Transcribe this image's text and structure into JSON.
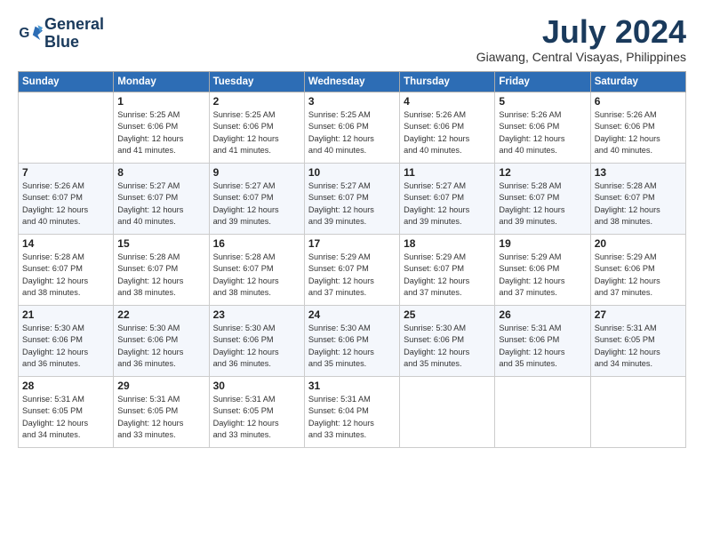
{
  "header": {
    "logo_line1": "General",
    "logo_line2": "Blue",
    "month": "July 2024",
    "location": "Giawang, Central Visayas, Philippines"
  },
  "weekdays": [
    "Sunday",
    "Monday",
    "Tuesday",
    "Wednesday",
    "Thursday",
    "Friday",
    "Saturday"
  ],
  "weeks": [
    [
      {
        "day": "",
        "info": ""
      },
      {
        "day": "1",
        "info": "Sunrise: 5:25 AM\nSunset: 6:06 PM\nDaylight: 12 hours\nand 41 minutes."
      },
      {
        "day": "2",
        "info": "Sunrise: 5:25 AM\nSunset: 6:06 PM\nDaylight: 12 hours\nand 41 minutes."
      },
      {
        "day": "3",
        "info": "Sunrise: 5:25 AM\nSunset: 6:06 PM\nDaylight: 12 hours\nand 40 minutes."
      },
      {
        "day": "4",
        "info": "Sunrise: 5:26 AM\nSunset: 6:06 PM\nDaylight: 12 hours\nand 40 minutes."
      },
      {
        "day": "5",
        "info": "Sunrise: 5:26 AM\nSunset: 6:06 PM\nDaylight: 12 hours\nand 40 minutes."
      },
      {
        "day": "6",
        "info": "Sunrise: 5:26 AM\nSunset: 6:06 PM\nDaylight: 12 hours\nand 40 minutes."
      }
    ],
    [
      {
        "day": "7",
        "info": "Sunrise: 5:26 AM\nSunset: 6:07 PM\nDaylight: 12 hours\nand 40 minutes."
      },
      {
        "day": "8",
        "info": "Sunrise: 5:27 AM\nSunset: 6:07 PM\nDaylight: 12 hours\nand 40 minutes."
      },
      {
        "day": "9",
        "info": "Sunrise: 5:27 AM\nSunset: 6:07 PM\nDaylight: 12 hours\nand 39 minutes."
      },
      {
        "day": "10",
        "info": "Sunrise: 5:27 AM\nSunset: 6:07 PM\nDaylight: 12 hours\nand 39 minutes."
      },
      {
        "day": "11",
        "info": "Sunrise: 5:27 AM\nSunset: 6:07 PM\nDaylight: 12 hours\nand 39 minutes."
      },
      {
        "day": "12",
        "info": "Sunrise: 5:28 AM\nSunset: 6:07 PM\nDaylight: 12 hours\nand 39 minutes."
      },
      {
        "day": "13",
        "info": "Sunrise: 5:28 AM\nSunset: 6:07 PM\nDaylight: 12 hours\nand 38 minutes."
      }
    ],
    [
      {
        "day": "14",
        "info": "Sunrise: 5:28 AM\nSunset: 6:07 PM\nDaylight: 12 hours\nand 38 minutes."
      },
      {
        "day": "15",
        "info": "Sunrise: 5:28 AM\nSunset: 6:07 PM\nDaylight: 12 hours\nand 38 minutes."
      },
      {
        "day": "16",
        "info": "Sunrise: 5:28 AM\nSunset: 6:07 PM\nDaylight: 12 hours\nand 38 minutes."
      },
      {
        "day": "17",
        "info": "Sunrise: 5:29 AM\nSunset: 6:07 PM\nDaylight: 12 hours\nand 37 minutes."
      },
      {
        "day": "18",
        "info": "Sunrise: 5:29 AM\nSunset: 6:07 PM\nDaylight: 12 hours\nand 37 minutes."
      },
      {
        "day": "19",
        "info": "Sunrise: 5:29 AM\nSunset: 6:06 PM\nDaylight: 12 hours\nand 37 minutes."
      },
      {
        "day": "20",
        "info": "Sunrise: 5:29 AM\nSunset: 6:06 PM\nDaylight: 12 hours\nand 37 minutes."
      }
    ],
    [
      {
        "day": "21",
        "info": "Sunrise: 5:30 AM\nSunset: 6:06 PM\nDaylight: 12 hours\nand 36 minutes."
      },
      {
        "day": "22",
        "info": "Sunrise: 5:30 AM\nSunset: 6:06 PM\nDaylight: 12 hours\nand 36 minutes."
      },
      {
        "day": "23",
        "info": "Sunrise: 5:30 AM\nSunset: 6:06 PM\nDaylight: 12 hours\nand 36 minutes."
      },
      {
        "day": "24",
        "info": "Sunrise: 5:30 AM\nSunset: 6:06 PM\nDaylight: 12 hours\nand 35 minutes."
      },
      {
        "day": "25",
        "info": "Sunrise: 5:30 AM\nSunset: 6:06 PM\nDaylight: 12 hours\nand 35 minutes."
      },
      {
        "day": "26",
        "info": "Sunrise: 5:31 AM\nSunset: 6:06 PM\nDaylight: 12 hours\nand 35 minutes."
      },
      {
        "day": "27",
        "info": "Sunrise: 5:31 AM\nSunset: 6:05 PM\nDaylight: 12 hours\nand 34 minutes."
      }
    ],
    [
      {
        "day": "28",
        "info": "Sunrise: 5:31 AM\nSunset: 6:05 PM\nDaylight: 12 hours\nand 34 minutes."
      },
      {
        "day": "29",
        "info": "Sunrise: 5:31 AM\nSunset: 6:05 PM\nDaylight: 12 hours\nand 33 minutes."
      },
      {
        "day": "30",
        "info": "Sunrise: 5:31 AM\nSunset: 6:05 PM\nDaylight: 12 hours\nand 33 minutes."
      },
      {
        "day": "31",
        "info": "Sunrise: 5:31 AM\nSunset: 6:04 PM\nDaylight: 12 hours\nand 33 minutes."
      },
      {
        "day": "",
        "info": ""
      },
      {
        "day": "",
        "info": ""
      },
      {
        "day": "",
        "info": ""
      }
    ]
  ]
}
